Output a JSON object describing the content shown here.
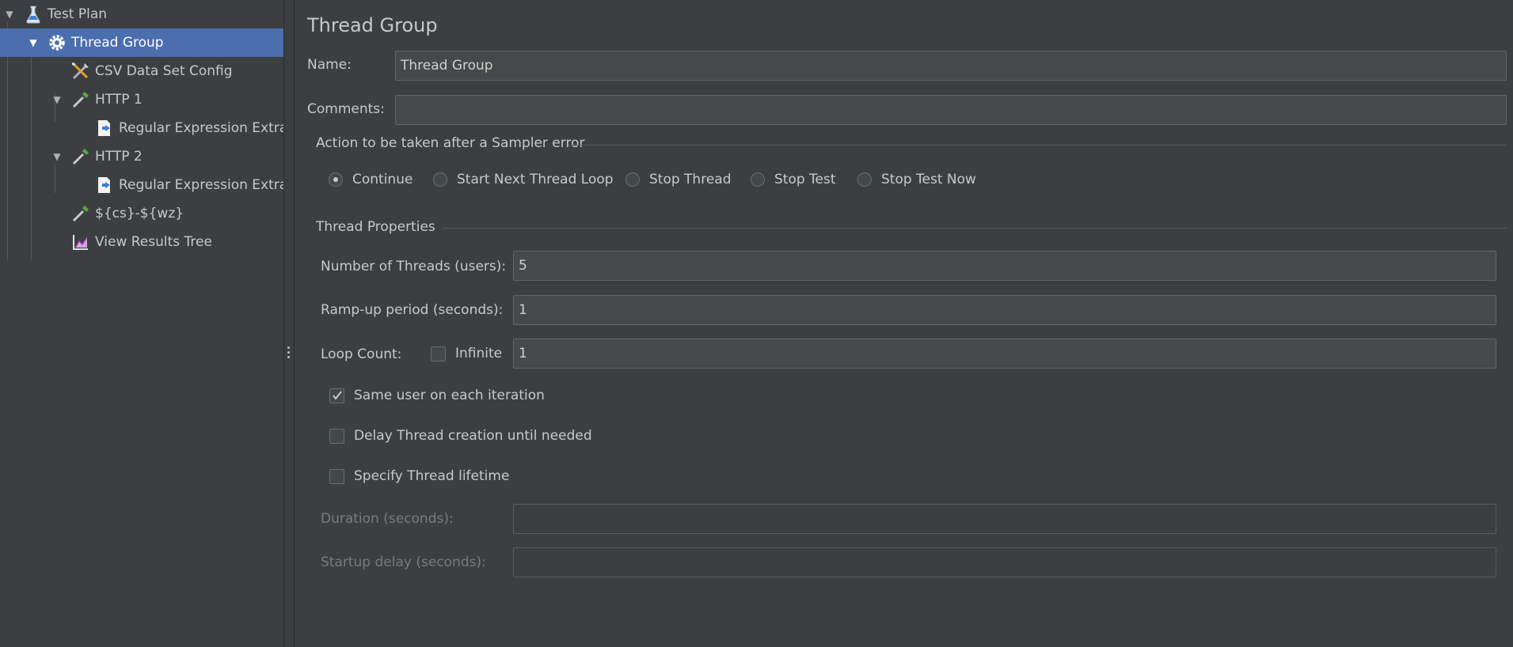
{
  "tree": {
    "items": [
      {
        "label": "Test Plan",
        "icon": "flask-icon"
      },
      {
        "label": "Thread Group",
        "icon": "gear-icon"
      },
      {
        "label": "CSV Data Set Config",
        "icon": "tools-icon"
      },
      {
        "label": "HTTP 1",
        "icon": "pipette-icon"
      },
      {
        "label": "Regular Expression Extra",
        "icon": "extractor-icon"
      },
      {
        "label": "HTTP 2",
        "icon": "pipette-icon"
      },
      {
        "label": "Regular Expression Extra",
        "icon": "extractor-icon"
      },
      {
        "label": "${cs}-${wz}",
        "icon": "pipette-icon"
      },
      {
        "label": "View Results Tree",
        "icon": "chart-icon"
      }
    ],
    "selected_index": 1
  },
  "panel": {
    "title": "Thread Group",
    "name_label": "Name:",
    "name_value": "Thread Group",
    "comments_label": "Comments:",
    "comments_value": ""
  },
  "sampler_error": {
    "legend": "Action to be taken after a Sampler error",
    "options": [
      "Continue",
      "Start Next Thread Loop",
      "Stop Thread",
      "Stop Test",
      "Stop Test Now"
    ],
    "selected": "Continue"
  },
  "thread_properties": {
    "legend": "Thread Properties",
    "threads_label": "Number of Threads (users):",
    "threads_value": "5",
    "rampup_label": "Ramp-up period (seconds):",
    "rampup_value": "1",
    "loop_label": "Loop Count:",
    "infinite_label": "Infinite",
    "infinite_checked": false,
    "loop_value": "1",
    "same_user_label": "Same user on each iteration",
    "same_user_checked": true,
    "delay_label": "Delay Thread creation until needed",
    "delay_checked": false,
    "lifetime_label": "Specify Thread lifetime",
    "lifetime_checked": false,
    "duration_label": "Duration (seconds):",
    "duration_value": "",
    "startup_label": "Startup delay (seconds):",
    "startup_value": ""
  },
  "colors": {
    "background": "#3c3f41",
    "selection": "#4b6eaf",
    "field": "#45494a"
  }
}
